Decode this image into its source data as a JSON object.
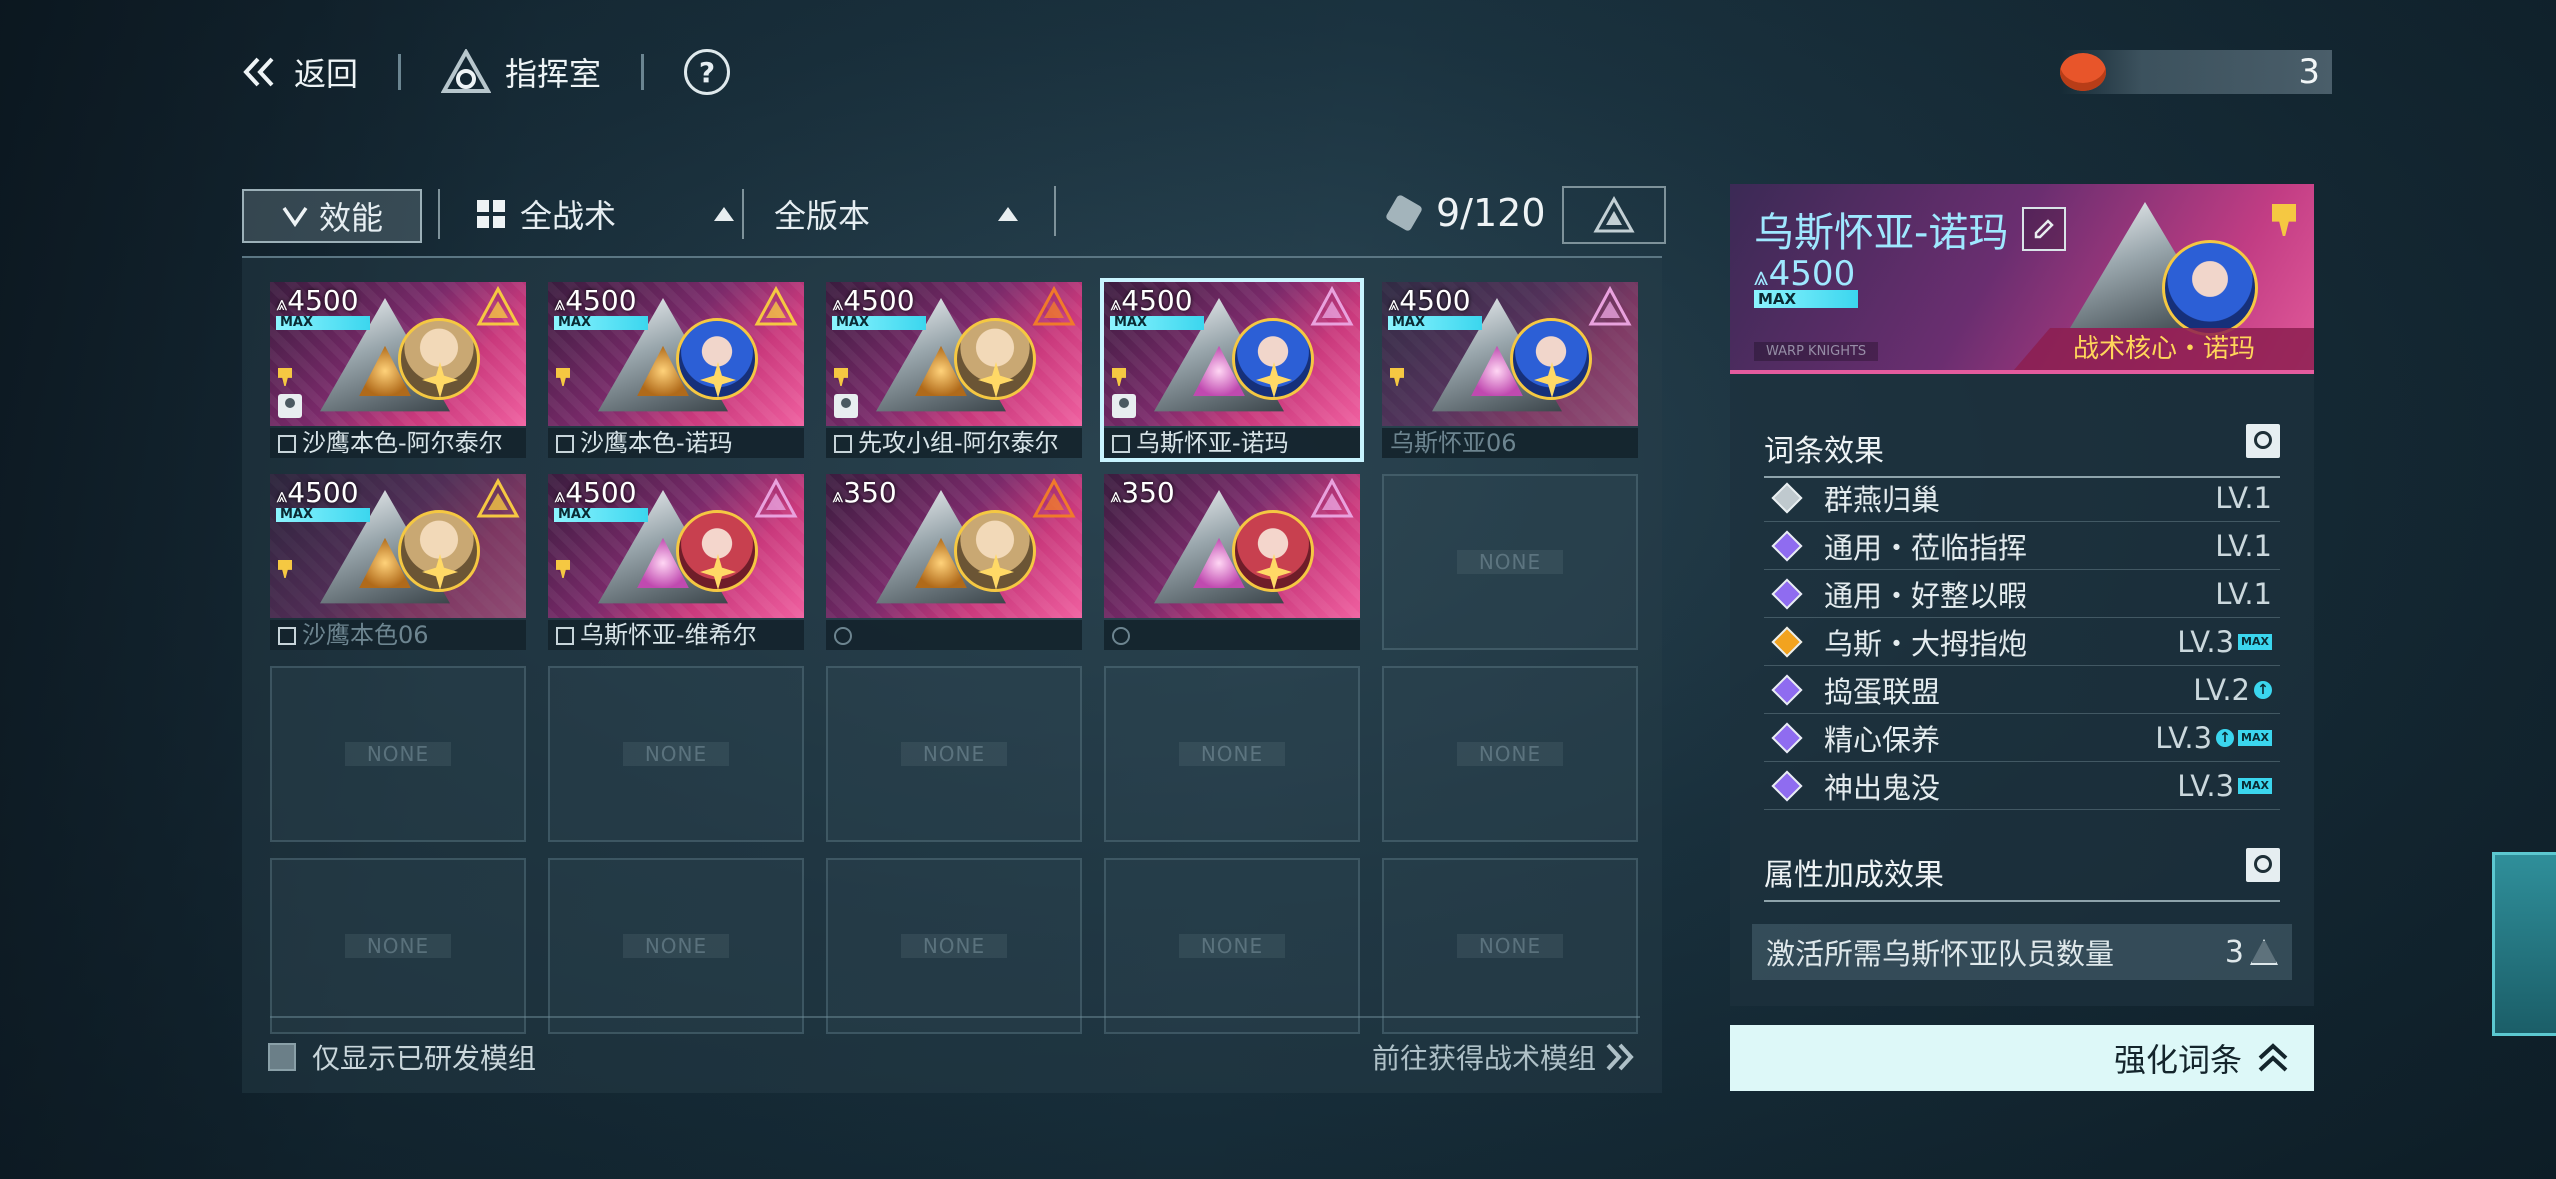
{
  "topbar": {
    "back_label": "返回",
    "command_label": "指挥室",
    "help_label": "?",
    "currency_value": "3"
  },
  "filters": {
    "effect_label": "效能",
    "tactic_label": "全战术",
    "version_label": "全版本",
    "count": "9/120"
  },
  "modules": [
    {
      "power": "4500",
      "max": "MAX",
      "name": "沙鹰本色-阿尔泰尔",
      "edit": true,
      "pinned": true,
      "user": true,
      "portrait": "blonde",
      "core": "gold",
      "emblem": "gold"
    },
    {
      "power": "4500",
      "max": "MAX",
      "name": "沙鹰本色-诺玛",
      "edit": true,
      "pinned": true,
      "user": false,
      "portrait": "blue",
      "core": "gold",
      "emblem": "gold"
    },
    {
      "power": "4500",
      "max": "MAX",
      "name": "先攻小组-阿尔泰尔",
      "edit": true,
      "pinned": true,
      "user": true,
      "portrait": "blonde",
      "core": "gold",
      "emblem": "orange"
    },
    {
      "power": "4500",
      "max": "MAX",
      "name": "乌斯怀亚-诺玛",
      "edit": true,
      "pinned": true,
      "user": true,
      "portrait": "blue",
      "core": "pink",
      "emblem": "pink",
      "selected": true
    },
    {
      "power": "4500",
      "max": "MAX",
      "name": "乌斯怀亚06",
      "edit": false,
      "pinned": true,
      "user": false,
      "portrait": "blue",
      "core": "pink",
      "emblem": "pink",
      "dim": true
    },
    {
      "power": "4500",
      "max": "MAX",
      "name": "沙鹰本色06",
      "edit": true,
      "pinned": true,
      "user": false,
      "portrait": "blonde",
      "core": "gold",
      "emblem": "gold",
      "dim": true
    },
    {
      "power": "4500",
      "max": "MAX",
      "name": "乌斯怀亚-维希尔",
      "edit": true,
      "pinned": true,
      "user": false,
      "portrait": "red",
      "core": "pink",
      "emblem": "pink"
    },
    {
      "power": "350",
      "max": "",
      "name": "",
      "edit": false,
      "pinned": false,
      "user": false,
      "portrait": "blonde",
      "core": "gold",
      "emblem": "orange",
      "ban": true
    },
    {
      "power": "350",
      "max": "",
      "name": "",
      "edit": false,
      "pinned": false,
      "user": false,
      "portrait": "red",
      "core": "pink",
      "emblem": "pink",
      "ban": true
    }
  ],
  "empty_label": "NONE",
  "footer": {
    "only_dev_label": "仅显示已研发模组",
    "goto_label": "前往获得战术模组"
  },
  "detail": {
    "title": "乌斯怀亚-诺玛",
    "power": "4500",
    "max": "MAX",
    "brand": "WARP KNIGHTS",
    "core_label": "战术核心・诺玛",
    "perks_title": "词条效果",
    "perks": [
      {
        "name": "群燕归巢",
        "level": "LV.1",
        "color": "#bfc9ce",
        "max": false,
        "up": false
      },
      {
        "name": "通用・莅临指挥",
        "level": "LV.1",
        "color": "#8f6cf0",
        "max": false,
        "up": false
      },
      {
        "name": "通用・好整以暇",
        "level": "LV.1",
        "color": "#8f6cf0",
        "max": false,
        "up": false
      },
      {
        "name": "乌斯・大拇指炮",
        "level": "LV.3",
        "color": "#f2a31f",
        "max": true,
        "up": false
      },
      {
        "name": "捣蛋联盟",
        "level": "LV.2",
        "color": "#8f6cf0",
        "max": false,
        "up": true
      },
      {
        "name": "精心保养",
        "level": "LV.3",
        "color": "#8f6cf0",
        "max": true,
        "up": true
      },
      {
        "name": "神出鬼没",
        "level": "LV.3",
        "color": "#8f6cf0",
        "max": true,
        "up": false
      }
    ],
    "attr_title": "属性加成效果",
    "attr_label": "激活所需乌斯怀亚队员数量",
    "attr_value": "3",
    "tag_max": "MAX",
    "tag_up": "↑"
  },
  "enhance_label": "强化词条",
  "colors": {
    "accent_cyan": "#3bd6ee",
    "card_pink": "#c9397c",
    "gold": "#f5c842",
    "currency_orange": "#e8552a"
  }
}
